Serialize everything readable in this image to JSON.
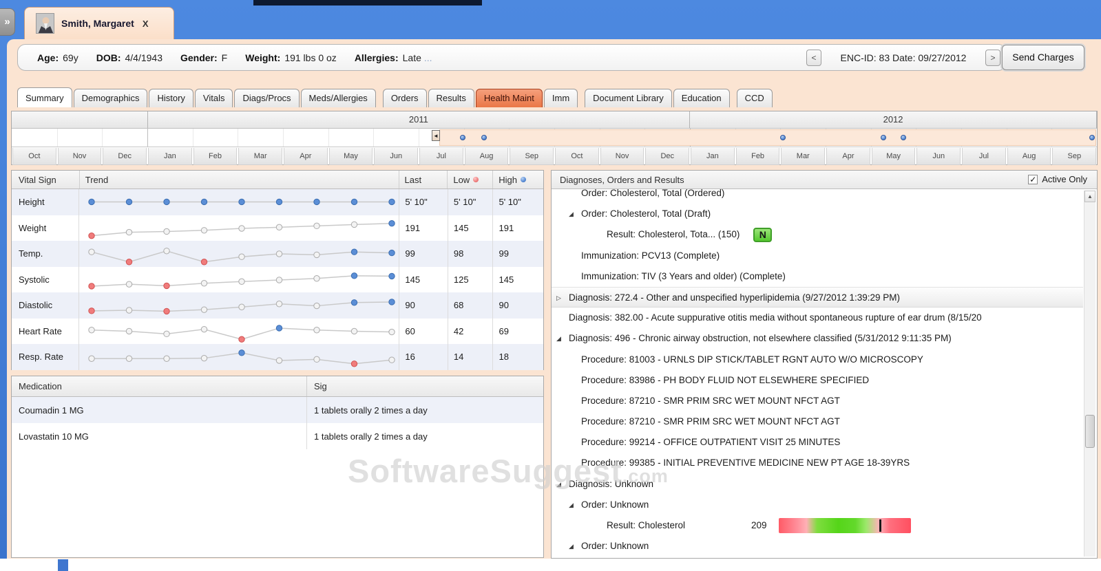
{
  "window": {
    "collapse_glyph": "»"
  },
  "patient_tab": {
    "name": "Smith, Margaret",
    "close_glyph": "X"
  },
  "info_bar": {
    "age_label": "Age:",
    "age": "69y",
    "dob_label": "DOB:",
    "dob": "4/4/1943",
    "gender_label": "Gender:",
    "gender": "F",
    "weight_label": "Weight:",
    "weight": "191 lbs 0 oz",
    "allergies_label": "Allergies:",
    "allergies": "Late",
    "allergies_more": "...",
    "prev_glyph": "<",
    "enc_text": "ENC-ID: 83 Date: 09/27/2012",
    "next_glyph": ">",
    "send_charges_label": "Send Charges"
  },
  "tabs": [
    {
      "label": "Summary",
      "state": "active"
    },
    {
      "label": "Demographics"
    },
    {
      "label": "History"
    },
    {
      "label": "Vitals"
    },
    {
      "label": "Diags/Procs"
    },
    {
      "label": "Meds/Allergies"
    },
    {
      "label": "Orders",
      "gap": true
    },
    {
      "label": "Results"
    },
    {
      "label": "Health Maint",
      "state": "highlighted"
    },
    {
      "label": "Imm"
    },
    {
      "label": "Document Library",
      "gap": true
    },
    {
      "label": "Education"
    },
    {
      "label": "CCD",
      "gap": true
    }
  ],
  "timeline": {
    "years": [
      {
        "label": "",
        "span": 3
      },
      {
        "label": "2011",
        "span": 12
      },
      {
        "label": "2012",
        "span": 9
      }
    ],
    "months": [
      "Oct",
      "Nov",
      "Dec",
      "Jan",
      "Feb",
      "Mar",
      "Apr",
      "May",
      "Jun",
      "Jul",
      "Aug",
      "Sep",
      "Oct",
      "Nov",
      "Dec",
      "Jan",
      "Feb",
      "Mar",
      "Apr",
      "May",
      "Jun",
      "Jul",
      "Aug",
      "Sep"
    ],
    "selection_start_pct": 39.4,
    "handle_glyph": "◄",
    "dot_positions_pct": [
      41.3,
      43.3,
      70.8,
      80.1,
      81.9,
      99.3
    ]
  },
  "vitals": {
    "headers": {
      "vital_sign": "Vital Sign",
      "trend": "Trend",
      "last": "Last",
      "low": "Low",
      "high": "High"
    },
    "rows": [
      {
        "name": "Height",
        "last": "5' 10\"",
        "low": "5' 10\"",
        "high": "5' 10\"",
        "spark": [
          [
            0.52,
            "blue"
          ],
          [
            0.52,
            "blue"
          ],
          [
            0.52,
            "blue"
          ],
          [
            0.52,
            "blue"
          ],
          [
            0.52,
            "blue"
          ],
          [
            0.52,
            "blue"
          ],
          [
            0.52,
            "blue"
          ],
          [
            0.52,
            "blue"
          ],
          [
            0.52,
            "blue"
          ]
        ]
      },
      {
        "name": "Weight",
        "last": "191",
        "low": "145",
        "high": "191",
        "spark": [
          [
            0.12,
            "red"
          ],
          [
            0.3,
            "gray"
          ],
          [
            0.34,
            "gray"
          ],
          [
            0.4,
            "gray"
          ],
          [
            0.5,
            "gray"
          ],
          [
            0.56,
            "gray"
          ],
          [
            0.63,
            "gray"
          ],
          [
            0.7,
            "gray"
          ],
          [
            0.76,
            "blue"
          ]
        ]
      },
      {
        "name": "Temp.",
        "last": "99",
        "low": "98",
        "high": "99",
        "spark": [
          [
            0.6,
            "gray"
          ],
          [
            0.08,
            "red"
          ],
          [
            0.65,
            "gray"
          ],
          [
            0.08,
            "red"
          ],
          [
            0.35,
            "gray"
          ],
          [
            0.5,
            "gray"
          ],
          [
            0.45,
            "gray"
          ],
          [
            0.6,
            "blue"
          ],
          [
            0.55,
            "blue"
          ]
        ]
      },
      {
        "name": "Systolic",
        "last": "145",
        "low": "125",
        "high": "145",
        "spark": [
          [
            0.18,
            "red"
          ],
          [
            0.28,
            "gray"
          ],
          [
            0.2,
            "red"
          ],
          [
            0.33,
            "gray"
          ],
          [
            0.42,
            "gray"
          ],
          [
            0.5,
            "gray"
          ],
          [
            0.58,
            "gray"
          ],
          [
            0.72,
            "blue"
          ],
          [
            0.7,
            "blue"
          ]
        ]
      },
      {
        "name": "Diastolic",
        "last": "90",
        "low": "68",
        "high": "90",
        "spark": [
          [
            0.22,
            "red"
          ],
          [
            0.25,
            "gray"
          ],
          [
            0.2,
            "red"
          ],
          [
            0.28,
            "gray"
          ],
          [
            0.42,
            "gray"
          ],
          [
            0.58,
            "gray"
          ],
          [
            0.48,
            "gray"
          ],
          [
            0.65,
            "blue"
          ],
          [
            0.68,
            "blue"
          ]
        ]
      },
      {
        "name": "Heart Rate",
        "last": "60",
        "low": "42",
        "high": "69",
        "spark": [
          [
            0.58,
            "gray"
          ],
          [
            0.52,
            "gray"
          ],
          [
            0.38,
            "gray"
          ],
          [
            0.62,
            "gray"
          ],
          [
            0.1,
            "red"
          ],
          [
            0.68,
            "blue"
          ],
          [
            0.58,
            "gray"
          ],
          [
            0.52,
            "gray"
          ],
          [
            0.48,
            "gray"
          ]
        ]
      },
      {
        "name": "Resp. Rate",
        "last": "16",
        "low": "14",
        "high": "18",
        "spark": [
          [
            0.42,
            "gray"
          ],
          [
            0.42,
            "gray"
          ],
          [
            0.42,
            "gray"
          ],
          [
            0.44,
            "gray"
          ],
          [
            0.72,
            "blue"
          ],
          [
            0.32,
            "gray"
          ],
          [
            0.38,
            "gray"
          ],
          [
            0.15,
            "red"
          ],
          [
            0.35,
            "gray"
          ]
        ]
      }
    ]
  },
  "medications": {
    "headers": {
      "medication": "Medication",
      "sig": "Sig"
    },
    "rows": [
      {
        "medication": "Coumadin 1 MG",
        "sig": "1 tablets orally 2 times a day"
      },
      {
        "medication": "Lovastatin 10 MG",
        "sig": "1 tablets orally 2 times a day"
      }
    ]
  },
  "dor_panel": {
    "title": "Diagnoses, Orders and Results",
    "active_only_label": "Active Only",
    "active_only_checked": "✓",
    "items": [
      {
        "indent": 1,
        "expander": "none",
        "text": "Order: Cholesterol, Total (Ordered)",
        "clipped_top": true
      },
      {
        "indent": 1,
        "expander": "expanded",
        "text": "Order: Cholesterol, Total (Draft)"
      },
      {
        "indent": 2,
        "expander": "none",
        "text": "Result: Cholesterol, Tota... (150)",
        "badge": "N"
      },
      {
        "indent": 1,
        "expander": "none",
        "text": "Immunization: PCV13 (Complete)"
      },
      {
        "indent": 1,
        "expander": "none",
        "text": "Immunization: TIV (3 Years and older) (Complete)"
      },
      {
        "indent": 0,
        "expander": "collapsed",
        "text": "Diagnosis: 272.4 - Other and unspecified hyperlipidemia (9/27/2012 1:39:29 PM)",
        "highlighted": true
      },
      {
        "indent": 0,
        "expander": "none",
        "text": "Diagnosis: 382.00 - Acute suppurative otitis media without spontaneous rupture of ear drum (8/15/20"
      },
      {
        "indent": 0,
        "expander": "expanded",
        "text": "Diagnosis: 496 - Chronic airway obstruction, not elsewhere classified (5/31/2012 9:11:35 PM)"
      },
      {
        "indent": 1,
        "expander": "none",
        "text": "Procedure: 81003 - URNLS DIP STICK/TABLET RGNT AUTO W/O MICROSCOPY"
      },
      {
        "indent": 1,
        "expander": "none",
        "text": "Procedure: 83986 - PH BODY FLUID NOT ELSEWHERE SPECIFIED"
      },
      {
        "indent": 1,
        "expander": "none",
        "text": "Procedure: 87210 - SMR PRIM SRC WET MOUNT NFCT AGT"
      },
      {
        "indent": 1,
        "expander": "none",
        "text": "Procedure: 87210 - SMR PRIM SRC WET MOUNT NFCT AGT"
      },
      {
        "indent": 1,
        "expander": "none",
        "text": "Procedure: 99214 - OFFICE OUTPATIENT VISIT 25 MINUTES"
      },
      {
        "indent": 1,
        "expander": "none",
        "text": "Procedure: 99385 - INITIAL PREVENTIVE MEDICINE NEW PT AGE 18-39YRS"
      },
      {
        "indent": 0,
        "expander": "expanded",
        "text": "Diagnosis: Unknown"
      },
      {
        "indent": 1,
        "expander": "expanded",
        "text": "Order: Unknown"
      },
      {
        "indent": 2,
        "expander": "none",
        "text": "Result: Cholesterol",
        "value": "209",
        "range_bar": true,
        "marker_pct": 76
      },
      {
        "indent": 1,
        "expander": "expanded",
        "text": "Order: Unknown"
      }
    ]
  },
  "watermark": {
    "text": "SoftwareSuggest",
    "suffix": ".com"
  },
  "colors": {
    "window_blue": "#3f7cd6",
    "peach": "#fbe4d2",
    "tab_highlight": "#ef8055",
    "badge_green": "#5ecb35",
    "dot_red": "#f07c7c",
    "dot_blue": "#5b8ed6"
  }
}
